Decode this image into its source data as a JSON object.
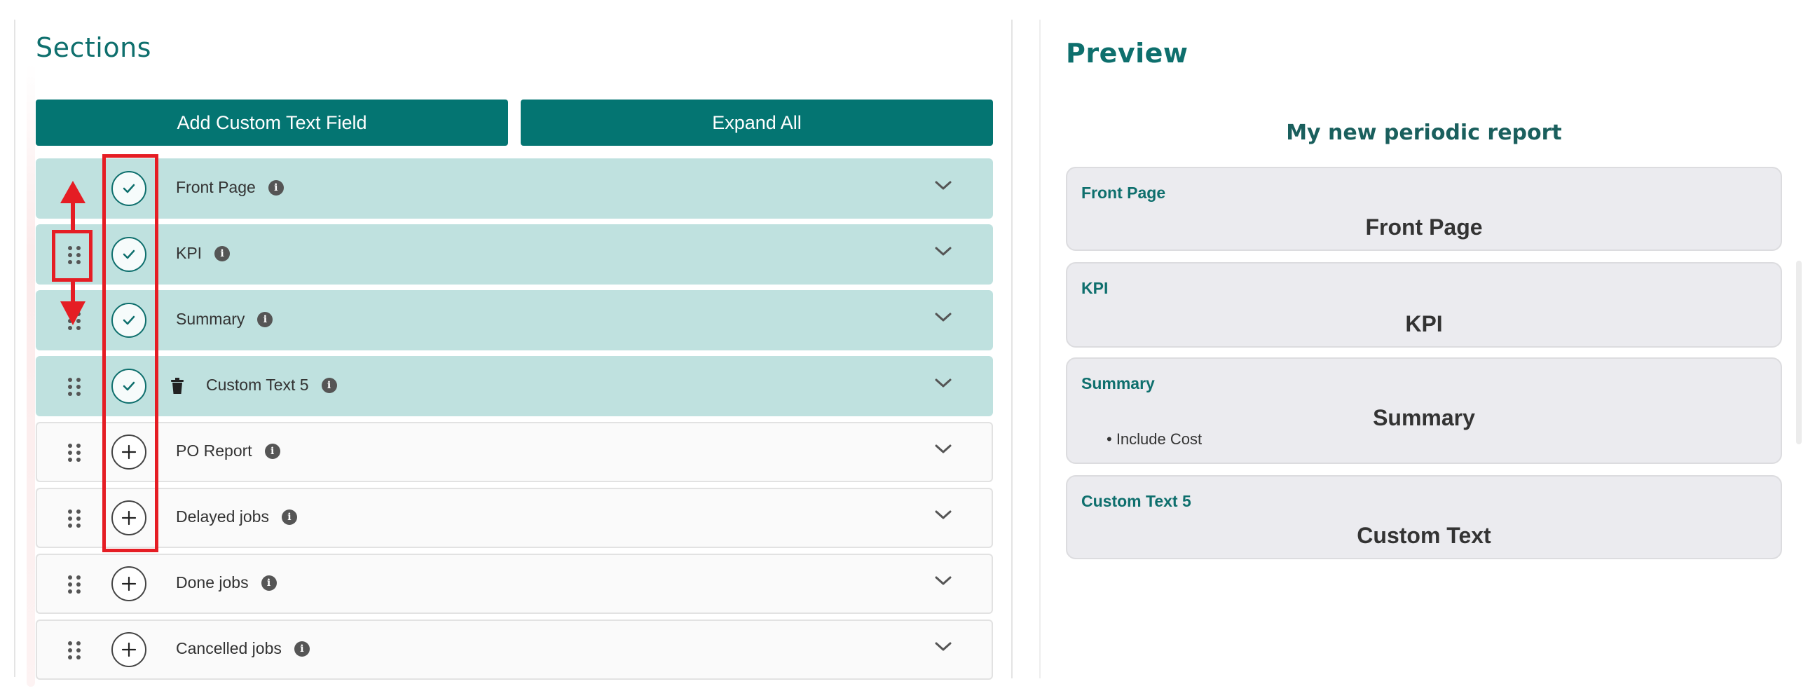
{
  "sections": {
    "title": "Sections",
    "add_button": "Add Custom Text Field",
    "expand_button": "Expand All",
    "items": [
      {
        "label": "Front Page",
        "state": "included",
        "deletable": false
      },
      {
        "label": "KPI",
        "state": "included",
        "deletable": false
      },
      {
        "label": "Summary",
        "state": "included",
        "deletable": false
      },
      {
        "label": "Custom Text 5",
        "state": "included",
        "deletable": true
      },
      {
        "label": "PO Report",
        "state": "excluded",
        "deletable": false
      },
      {
        "label": "Delayed jobs",
        "state": "excluded",
        "deletable": false
      },
      {
        "label": "Done jobs",
        "state": "excluded",
        "deletable": false
      },
      {
        "label": "Cancelled jobs",
        "state": "excluded",
        "deletable": false
      }
    ]
  },
  "preview": {
    "title": "Preview",
    "report_title": "My new periodic report",
    "cards": [
      {
        "label": "Front Page",
        "content": "Front Page"
      },
      {
        "label": "KPI",
        "content": "KPI"
      },
      {
        "label": "Summary",
        "content": "Summary",
        "bullet": "• Include Cost"
      },
      {
        "label": "Custom Text 5",
        "content": "Custom Text"
      }
    ]
  },
  "icons": {
    "drag": "drag-handle-icon",
    "included": "check-circle-icon",
    "excluded": "plus-circle-icon",
    "delete": "trash-icon",
    "info": "info-icon",
    "expand": "chevron-down-icon"
  },
  "colors": {
    "accent": "#047572",
    "included_row": "#bfe1df",
    "annotation": "#e51d24"
  }
}
